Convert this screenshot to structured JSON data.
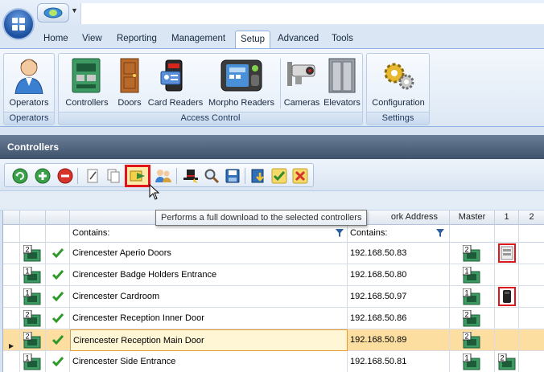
{
  "ribbon_tabs": [
    "Home",
    "View",
    "Reporting",
    "Management",
    "Setup",
    "Advanced",
    "Tools"
  ],
  "active_tab": "Setup",
  "groups": {
    "operators": {
      "label": "Operators",
      "buttons": [
        "Operators"
      ]
    },
    "access_control": {
      "label": "Access Control",
      "buttons": [
        "Controllers",
        "Doors",
        "Card Readers",
        "Morpho Readers",
        "Cameras",
        "Elevators"
      ]
    },
    "settings": {
      "label": "Settings",
      "buttons": [
        "Configuration"
      ]
    }
  },
  "panel": {
    "title": "Controllers"
  },
  "toolbar": {
    "icons": [
      "refresh-icon",
      "add-icon",
      "delete-icon",
      "edit-icon",
      "copy-icon",
      "full-download-icon",
      "users-download-icon",
      "hat-icon",
      "search-icon",
      "save-icon",
      "download-icon",
      "accept-icon",
      "reject-icon"
    ],
    "highlighted": "full-download-icon"
  },
  "tooltip": "Performs a full download to the selected controllers",
  "grid": {
    "columns": [
      "",
      "",
      "",
      "Network Address",
      "Master",
      "1",
      "2"
    ],
    "network_header_visible": "ork Address",
    "filter_contains_name": "Contains:",
    "filter_contains_address": "Contains:",
    "rows": [
      {
        "badge": "2",
        "name": "Cirencester Aperio Doors",
        "address": "192.168.50.83",
        "master_badge": "2",
        "col1": "aperio-lock-icon",
        "col2": ""
      },
      {
        "badge": "1",
        "name": "Cirencester Badge Holders Entrance",
        "address": "192.168.50.80",
        "master_badge": "1",
        "col1": "",
        "col2": ""
      },
      {
        "badge": "1",
        "name": "Cirencester Cardroom",
        "address": "192.168.50.97",
        "master_badge": "1",
        "col1": "card-reader-icon",
        "col2": ""
      },
      {
        "badge": "2",
        "name": "Cirencester Reception Inner Door",
        "address": "192.168.50.86",
        "master_badge": "2",
        "col1": "",
        "col2": ""
      },
      {
        "badge": "2",
        "name": "Cirencester Reception Main Door",
        "address": "192.168.50.89",
        "master_badge": "2",
        "col1": "",
        "col2": "",
        "selected": true
      },
      {
        "badge": "1",
        "name": "Cirencester Side Entrance",
        "address": "192.168.50.81",
        "master_badge": "1",
        "col1": "controller-2-icon",
        "col2": ""
      }
    ]
  },
  "colors": {
    "accent": "#e0161b",
    "selection": "#fcdfa0",
    "header": "#3f526c"
  }
}
